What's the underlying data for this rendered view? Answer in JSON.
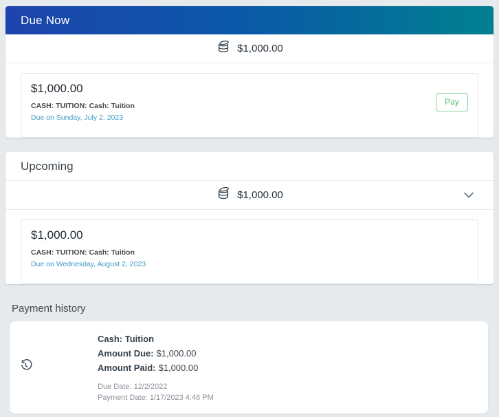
{
  "due_now": {
    "title": "Due Now",
    "total_amount": "$1,000.00",
    "item": {
      "amount": "$1,000.00",
      "category": "CASH: TUITION: Cash: Tuition",
      "due_text": "Due on Sunday, July 2, 2023",
      "pay_label": "Pay"
    }
  },
  "upcoming": {
    "title": "Upcoming",
    "total_amount": "$1,000.00",
    "item": {
      "amount": "$1,000.00",
      "category": "CASH: TUITION: Cash: Tuition",
      "due_text": "Due on Wednesday, August 2, 2023"
    }
  },
  "payment_history": {
    "title": "Payment history",
    "entry": {
      "name": "Cash: Tuition",
      "amount_due_label": "Amount Due:",
      "amount_due_value": "$1,000.00",
      "amount_paid_label": "Amount Paid:",
      "amount_paid_value": "$1,000.00",
      "due_date": "Due Date: 12/2/2022",
      "payment_date": "Payment Date: 1/17/2023 4:46 PM"
    }
  },
  "icons": {
    "coins": "coins-icon",
    "history": "history-icon",
    "chevron_down": "chevron-down-icon"
  },
  "colors": {
    "header_gradient_start": "#1e44ad",
    "header_gradient_end": "#00808f",
    "due_link_blue": "#3d9cc6",
    "pay_green": "#56ba6d",
    "page_bg": "#e7eaed"
  }
}
